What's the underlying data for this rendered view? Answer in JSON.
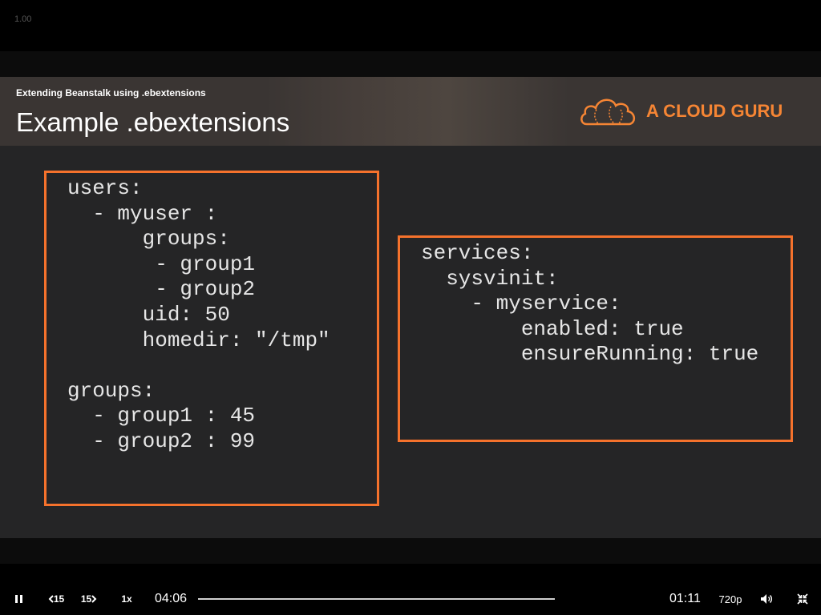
{
  "zoom_label": "1.00",
  "slide": {
    "subtitle": "Extending Beanstalk using .ebextensions",
    "title": "Example .ebextensions",
    "brand": "A CLOUD GURU",
    "accent_color": "#f5722c",
    "code_left": "users:\n  - myuser :\n      groups:\n       - group1\n       - group2\n      uid: 50\n      homedir: \"/tmp\"\n\ngroups:\n  - group1 : 45\n  - group2 : 99",
    "code_right": "services:\n  sysvinit:\n    - myservice:\n        enabled: true\n        ensureRunning: true"
  },
  "controls": {
    "play_state_icon": "pause-icon",
    "skip_back_label": "15",
    "skip_forward_label": "15",
    "speed_label": "1x",
    "elapsed_time": "04:06",
    "remaining_time": "01:11",
    "quality_label": "720p",
    "volume_icon": "volume-icon",
    "exit_fullscreen_icon": "exit-fullscreen-icon"
  }
}
